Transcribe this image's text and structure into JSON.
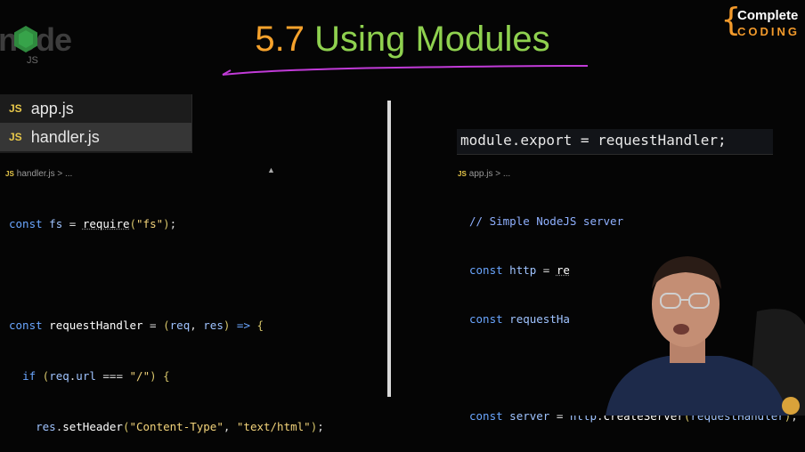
{
  "title": {
    "number": "5.7",
    "text": "Using Modules"
  },
  "brand": {
    "top": "Complete",
    "bottom": "CODING"
  },
  "logo": {
    "word": "node",
    "badge": "JS"
  },
  "file_list": [
    {
      "icon": "JS",
      "name": "app.js"
    },
    {
      "icon": "JS",
      "name": "handler.js"
    }
  ],
  "left_pane": {
    "breadcrumb": "handler.js > ...",
    "lines": [
      "const fs = require(\"fs\");",
      "",
      "const requestHandler = (req, res) => {",
      "  if (req.url === \"/\") {",
      "    res.setHeader(\"Content-Type\", \"text/html\");"
    ]
  },
  "right_pane": {
    "export_line": "module.export = requestHandler;",
    "breadcrumb": "app.js > ...",
    "lines": [
      "// Simple NodeJS server",
      "const http = require('http');",
      "const requestHandler = require('./handler');",
      "",
      "const server = http.createServer(requestHandler);"
    ]
  },
  "colors": {
    "title_number": "#f6a22c",
    "title_text": "#8fd14f",
    "underline": "#c13bd8",
    "brand_orange": "#f39a2b"
  }
}
